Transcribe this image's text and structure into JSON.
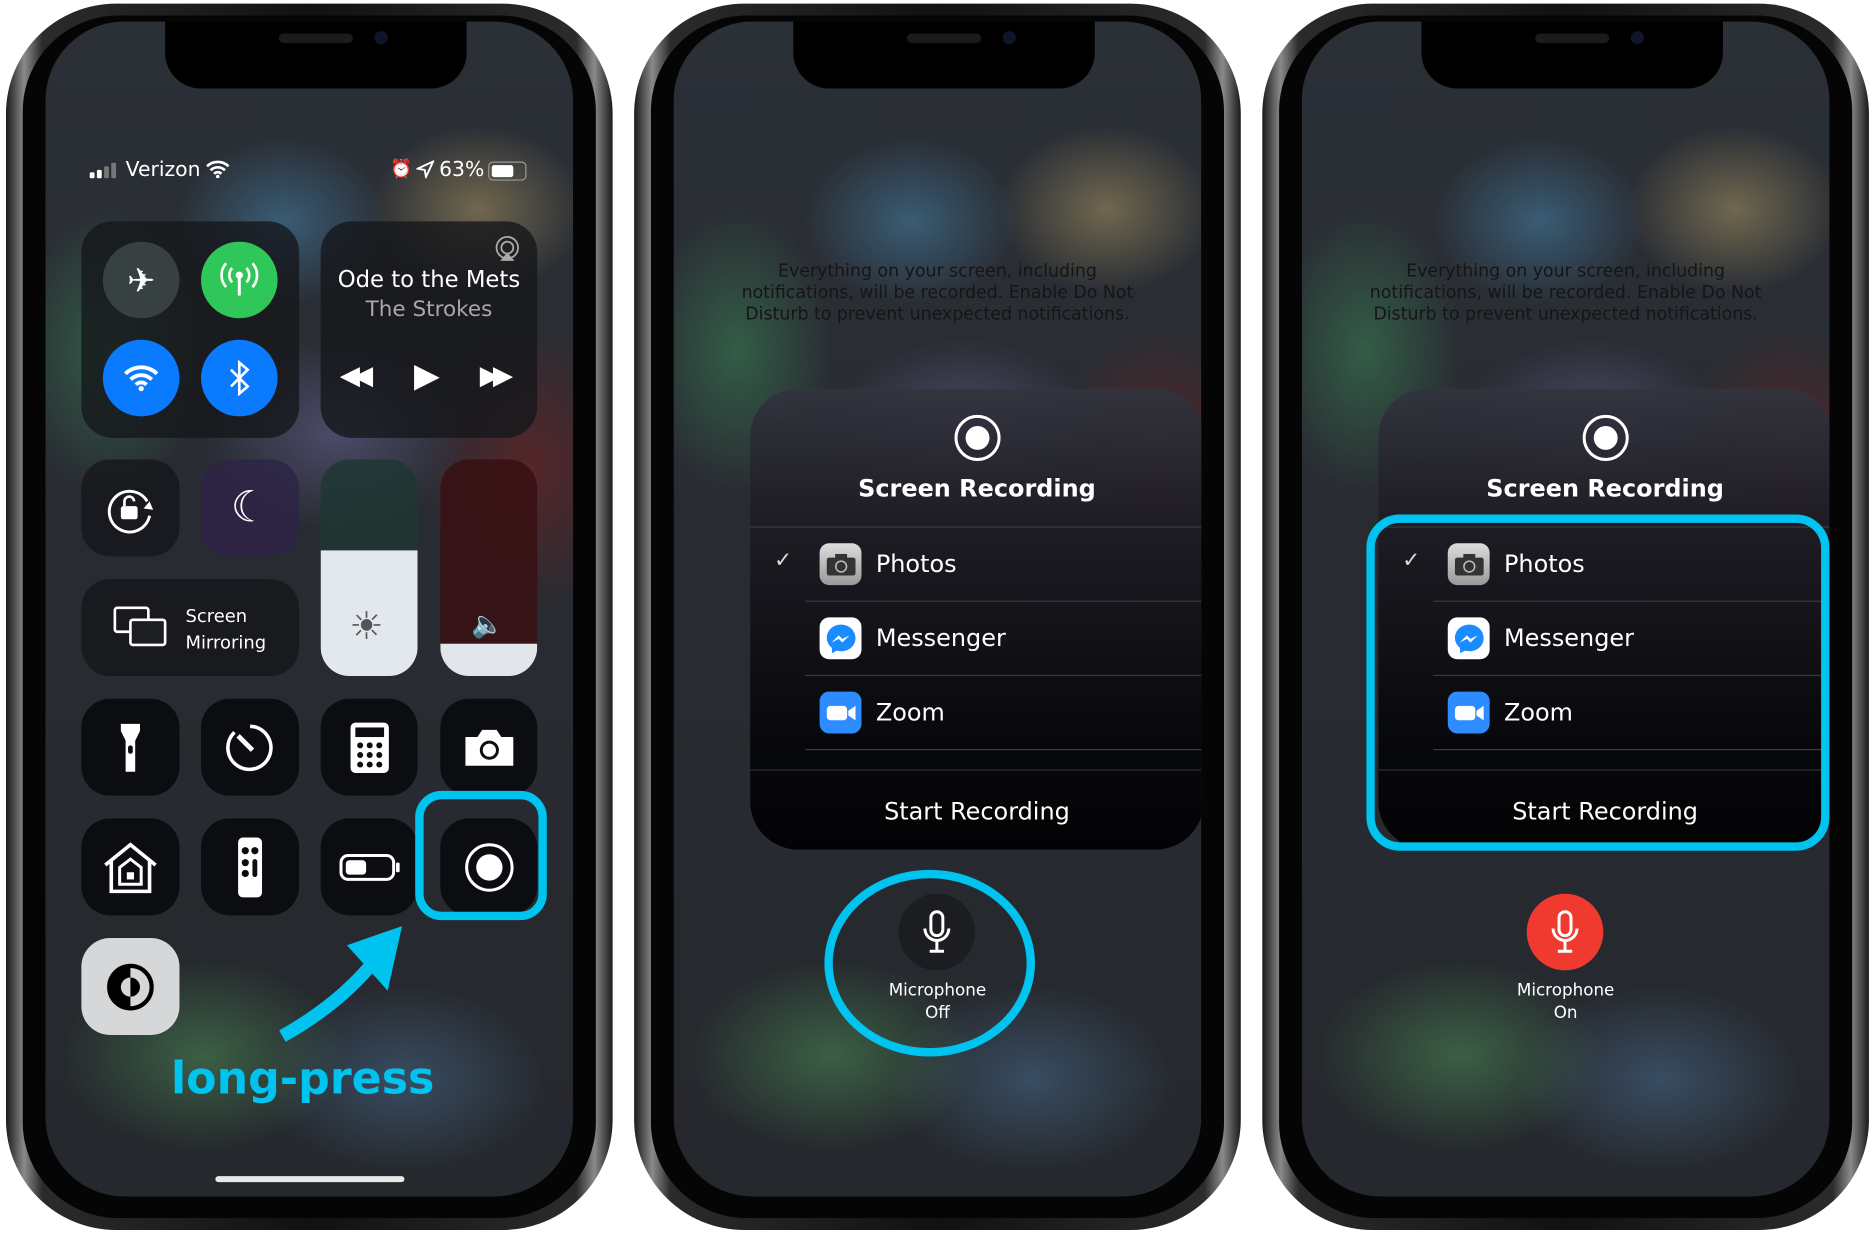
{
  "accent_color": "#00c3f0",
  "phone1": {
    "status": {
      "carrier": "Verizon",
      "battery": "63%"
    },
    "now_playing": {
      "title": "Ode to the Mets",
      "artist": "The Strokes"
    },
    "screen_mirroring": {
      "line1": "Screen",
      "line2": "Mirroring"
    },
    "brightness_level": 0.58,
    "volume_level": 0.15,
    "annotation": "long-press"
  },
  "phone2": {
    "notice": [
      "Everything on your screen, including",
      "notifications, will be recorded. Enable Do Not",
      "Disturb to prevent unexpected notifications."
    ],
    "title": "Screen Recording",
    "apps": [
      {
        "label": "Photos",
        "checked": true
      },
      {
        "label": "Messenger",
        "checked": false
      },
      {
        "label": "Zoom",
        "checked": false
      }
    ],
    "start_label": "Start Recording",
    "mic_label": "Microphone",
    "mic_state": "Off",
    "mic_color": "#1c1d20"
  },
  "phone3": {
    "notice": [
      "Everything on your screen, including",
      "notifications, will be recorded. Enable Do Not",
      "Disturb to prevent unexpected notifications."
    ],
    "title": "Screen Recording",
    "apps": [
      {
        "label": "Photos",
        "checked": true
      },
      {
        "label": "Messenger",
        "checked": false
      },
      {
        "label": "Zoom",
        "checked": false
      }
    ],
    "start_label": "Start Recording",
    "mic_label": "Microphone",
    "mic_state": "On",
    "mic_color": "#f03a30"
  }
}
